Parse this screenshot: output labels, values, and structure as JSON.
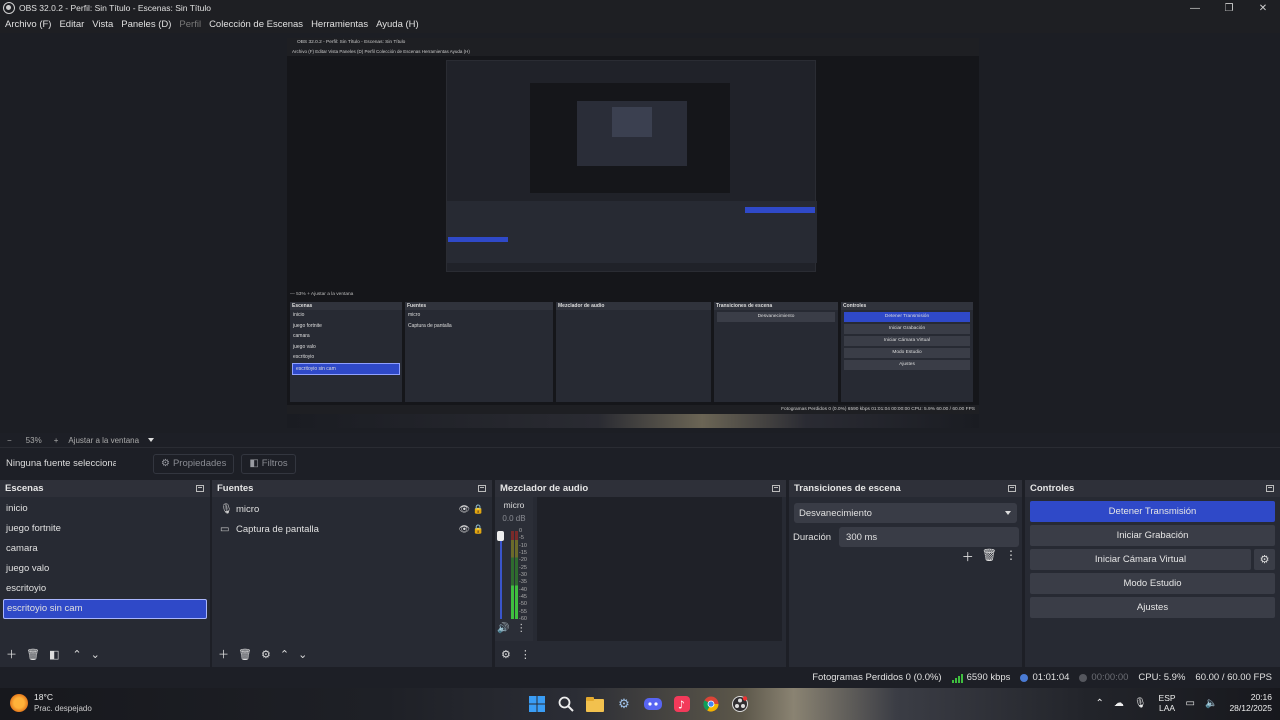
{
  "window": {
    "title": "OBS 32.0.2 - Perfil: Sin Título - Escenas: Sin Título",
    "minimize": "—",
    "maximize": "❐",
    "close": "✕"
  },
  "menu": {
    "items": [
      "Archivo (F)",
      "Editar",
      "Vista",
      "Paneles (D)",
      "Perfil",
      "Colección de Escenas",
      "Herramientas",
      "Ayuda (H)"
    ]
  },
  "preview_nested": {
    "title": "OBS 32.0.2 - Perfil: Sin Título - Escenas: Sin Título",
    "menu": "Archivo (F)   Editar   Vista   Paneles (D)   Perfil   Colección de Escenas   Herramientas   Ayuda (H)",
    "zoom": "—  53%  +  Ajustar a la ventana",
    "source_bar": "Ninguna fuente seleccionada   ⚙ Propiedades   ◧ Filtros",
    "docks": {
      "scenes_title": "Escenas",
      "sources_title": "Fuentes",
      "mixer_title": "Mezclador de audio",
      "transitions_title": "Transiciones de escena",
      "controls_title": "Controles"
    },
    "status": "Fotogramas Perdidos 0 (0.0%)   6590 kbps   01:01:04   00:00:00   CPU: 5.9%   60.00 / 60.00 FPS"
  },
  "zoom": {
    "minus": "−",
    "percent": "53%",
    "plus": "+",
    "fit_label": "Ajustar a la ventana"
  },
  "source_toolbar": {
    "none_selected": "Ninguna fuente seleccionada",
    "properties_label": "Propiedades",
    "properties_icon": "gear-icon",
    "filters_label": "Filtros",
    "filters_icon": "filter-icon"
  },
  "scenes": {
    "title": "Escenas",
    "items": [
      "inicio",
      "juego fortnite",
      "camara",
      "juego valo",
      "escritoyio",
      "escritoyio sin cam"
    ],
    "selected_index": 5
  },
  "sources": {
    "title": "Fuentes",
    "items": [
      {
        "name": "micro",
        "icon": "microphone-icon"
      },
      {
        "name": "Captura de pantalla",
        "icon": "monitor-icon"
      }
    ]
  },
  "mixer": {
    "title": "Mezclador de audio",
    "channel_name": "micro",
    "channel_db": "0.0 dB",
    "ticks": [
      "0",
      "-5",
      "-10",
      "-15",
      "-20",
      "-25",
      "-30",
      "-35",
      "-40",
      "-45",
      "-50",
      "-55",
      "-60"
    ]
  },
  "transitions": {
    "title": "Transiciones de escena",
    "selected": "Desvanecimiento",
    "duration_label": "Duración",
    "duration_value": "300 ms"
  },
  "controls": {
    "title": "Controles",
    "stop_stream": "Detener Transmisión",
    "start_recording": "Iniciar Grabación",
    "start_virtual_cam": "Iniciar Cámara Virtual",
    "studio_mode": "Modo Estudio",
    "settings": "Ajustes"
  },
  "status": {
    "dropped_frames": "Fotogramas Perdidos 0 (0.0%)",
    "bitrate": "6590 kbps",
    "stream_time": "01:01:04",
    "rec_time": "00:00:00",
    "cpu": "CPU: 5.9%",
    "fps": "60.00 / 60.00 FPS"
  },
  "taskbar": {
    "temperature": "18°C",
    "weather": "Prac. despejado",
    "lang_top": "ESP",
    "lang_bottom": "LAA",
    "time": "20:16",
    "date": "28/12/2025"
  },
  "colors": {
    "accent": "#2f49c8",
    "panel": "#272a33",
    "background": "#1d1f26"
  }
}
